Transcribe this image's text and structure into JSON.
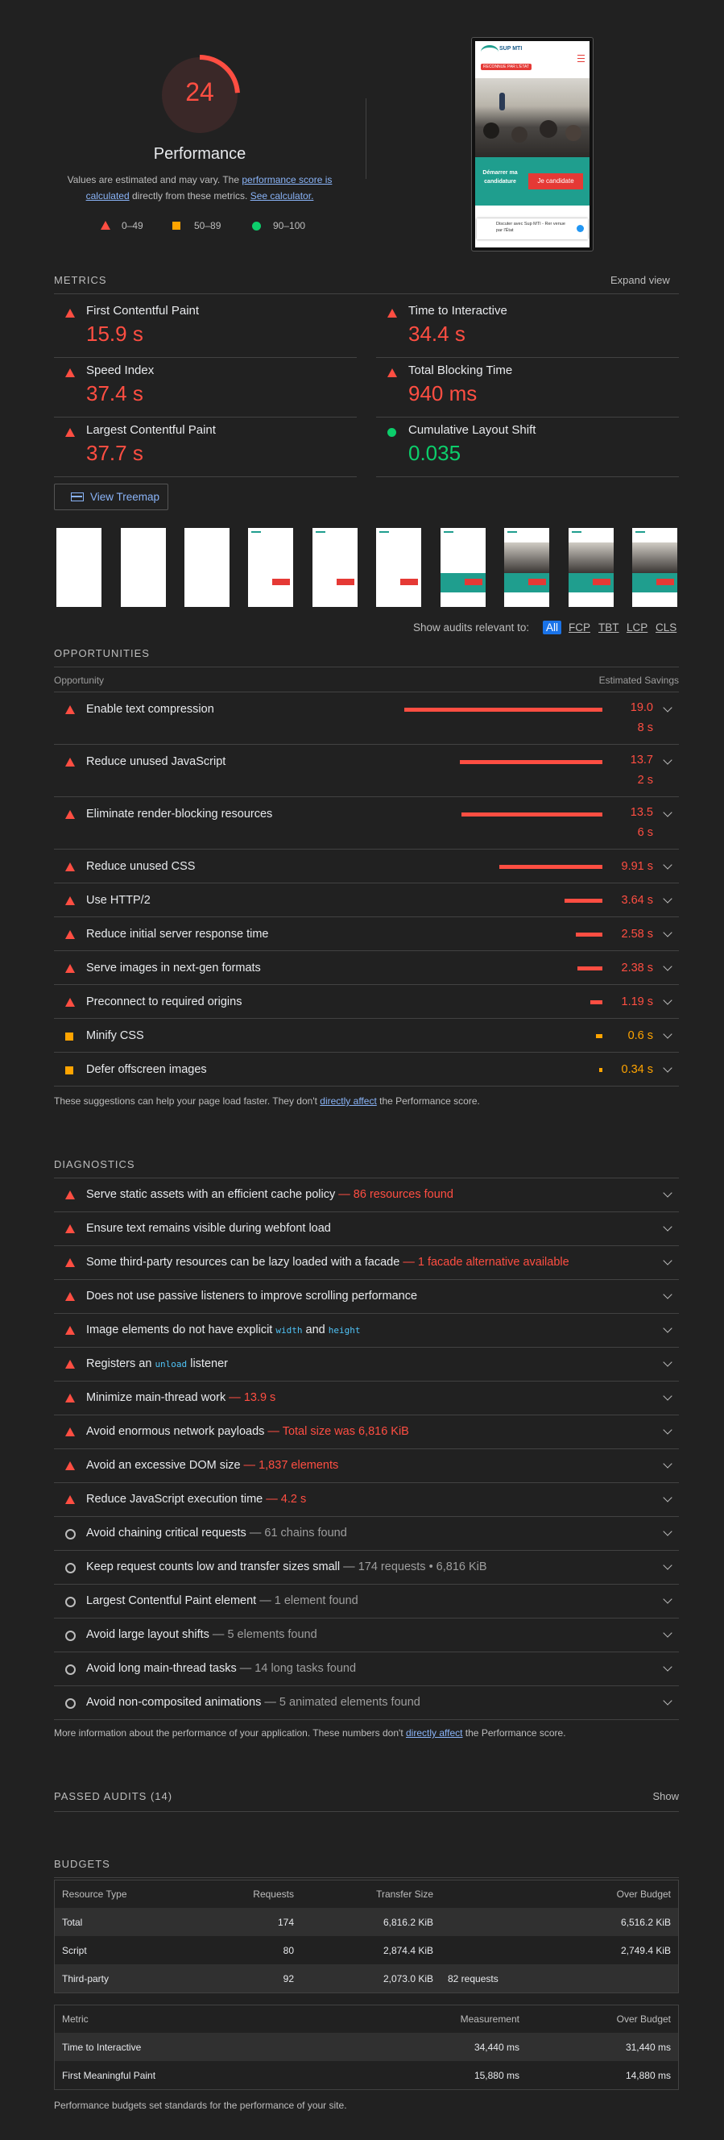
{
  "gauge": {
    "score": "24",
    "label": "Performance",
    "fraction": 0.24,
    "color": "#ff4e42"
  },
  "summary": {
    "text_pre": "Values are estimated and may vary. The ",
    "link1a": "performance score is",
    "link1b": "calculated",
    "text_mid": " directly from these metrics. ",
    "link2": "See calculator."
  },
  "legend": {
    "fail": "0–49",
    "average": "50–89",
    "pass": "90–100"
  },
  "phone": {
    "brand": "SUP MTI",
    "badge": "RECONNUE PAR L'ÉTAT",
    "cta_text": "Démarrer ma candidature",
    "cta_button": "Je candidate",
    "chat_text": "Discuter avec Sup MTI - Rer venue par l'État"
  },
  "metrics": {
    "header": "METRICS",
    "expand": "Expand view",
    "fcp": {
      "label": "First Contentful Paint",
      "value": "15.9 s"
    },
    "tti": {
      "label": "Time to Interactive",
      "value": "34.4 s"
    },
    "si": {
      "label": "Speed Index",
      "value": "37.4 s"
    },
    "tbt": {
      "label": "Total Blocking Time",
      "value": "940 ms"
    },
    "lcp": {
      "label": "Largest Contentful Paint",
      "value": "37.7 s"
    },
    "cls": {
      "label": "Cumulative Layout Shift",
      "value": "0.035"
    }
  },
  "treemap": {
    "label": "View Treemap"
  },
  "filter": {
    "label": "Show audits relevant to:",
    "options": [
      "All",
      "FCP",
      "TBT",
      "LCP",
      "CLS"
    ]
  },
  "opportunities": {
    "header": "OPPORTUNITIES",
    "col_left": "Opportunity",
    "col_right": "Estimated Savings",
    "items": [
      {
        "title": "Enable text compression",
        "savings": "19.08 s",
        "savings_s": 19.08,
        "level": "fail"
      },
      {
        "title": "Reduce unused JavaScript",
        "savings": "13.72 s",
        "savings_s": 13.72,
        "level": "fail"
      },
      {
        "title": "Eliminate render-blocking resources",
        "savings": "13.56 s",
        "savings_s": 13.56,
        "level": "fail"
      },
      {
        "title": "Reduce unused CSS",
        "savings": "9.91 s",
        "savings_s": 9.91,
        "level": "fail"
      },
      {
        "title": "Use HTTP/2",
        "savings": "3.64 s",
        "savings_s": 3.64,
        "level": "fail"
      },
      {
        "title": "Reduce initial server response time",
        "savings": "2.58 s",
        "savings_s": 2.58,
        "level": "fail"
      },
      {
        "title": "Serve images in next-gen formats",
        "savings": "2.38 s",
        "savings_s": 2.38,
        "level": "fail"
      },
      {
        "title": "Preconnect to required origins",
        "savings": "1.19 s",
        "savings_s": 1.19,
        "level": "fail"
      },
      {
        "title": "Minify CSS",
        "savings": "0.6 s",
        "savings_s": 0.6,
        "level": "average"
      },
      {
        "title": "Defer offscreen images",
        "savings": "0.34 s",
        "savings_s": 0.34,
        "level": "average"
      }
    ],
    "footer_pre": "These suggestions can help your page load faster. They don't ",
    "footer_link": "directly affect",
    "footer_post": " the Performance score."
  },
  "diagnostics": {
    "header": "DIAGNOSTICS",
    "items": [
      {
        "title": "Serve static assets with an efficient cache policy",
        "detail": "86 resources found",
        "level": "fail"
      },
      {
        "title": "Ensure text remains visible during webfont load",
        "detail": "",
        "level": "fail"
      },
      {
        "title": "Some third-party resources can be lazy loaded with a facade",
        "detail": "1 facade alternative available",
        "level": "fail"
      },
      {
        "title": "Does not use passive listeners to improve scrolling performance",
        "detail": "",
        "level": "fail"
      },
      {
        "title": "Image elements do not have explicit ",
        "code1": "width",
        "mid": " and ",
        "code2": "height",
        "detail": "",
        "level": "fail"
      },
      {
        "title": "Registers an ",
        "code1": "unload",
        "mid": " listener",
        "detail": "",
        "level": "fail"
      },
      {
        "title": "Minimize main-thread work",
        "detail": "13.9 s",
        "level": "fail"
      },
      {
        "title": "Avoid enormous network payloads",
        "detail": "Total size was 6,816 KiB",
        "level": "fail"
      },
      {
        "title": "Avoid an excessive DOM size",
        "detail": "1,837 elements",
        "level": "fail"
      },
      {
        "title": "Reduce JavaScript execution time",
        "detail": "4.2 s",
        "level": "fail"
      },
      {
        "title": "Avoid chaining critical requests",
        "detail": "61 chains found",
        "level": "info"
      },
      {
        "title": "Keep request counts low and transfer sizes small",
        "detail": "174 requests • 6,816 KiB",
        "level": "info"
      },
      {
        "title": "Largest Contentful Paint element",
        "detail": "1 element found",
        "level": "info"
      },
      {
        "title": "Avoid large layout shifts",
        "detail": "5 elements found",
        "level": "info"
      },
      {
        "title": "Avoid long main-thread tasks",
        "detail": "14 long tasks found",
        "level": "info"
      },
      {
        "title": "Avoid non-composited animations",
        "detail": "5 animated elements found",
        "level": "info"
      }
    ],
    "footer_pre": "More information about the performance of your application. These numbers don't ",
    "footer_link": "directly affect",
    "footer_post": " the Performance score."
  },
  "passed": {
    "label": "PASSED AUDITS (14)",
    "show": "Show"
  },
  "budgets": {
    "header": "BUDGETS",
    "resource_headers": [
      "Resource Type",
      "Requests",
      "Transfer Size",
      "",
      "Over Budget"
    ],
    "resource_rows": [
      {
        "type": "Total",
        "requests": "174",
        "size": "6,816.2 KiB",
        "extra": "",
        "over": "6,516.2 KiB"
      },
      {
        "type": "Script",
        "requests": "80",
        "size": "2,874.4 KiB",
        "extra": "",
        "over": "2,749.4 KiB"
      },
      {
        "type": "Third-party",
        "requests": "92",
        "size": "2,073.0 KiB",
        "extra": "82 requests",
        "over": ""
      }
    ],
    "metric_headers": [
      "Metric",
      "Measurement",
      "Over Budget"
    ],
    "metric_rows": [
      {
        "metric": "Time to Interactive",
        "measurement": "34,440 ms",
        "over": "31,440 ms"
      },
      {
        "metric": "First Meaningful Paint",
        "measurement": "15,880 ms",
        "over": "14,880 ms"
      }
    ],
    "footer": "Performance budgets set standards for the performance of your site."
  }
}
